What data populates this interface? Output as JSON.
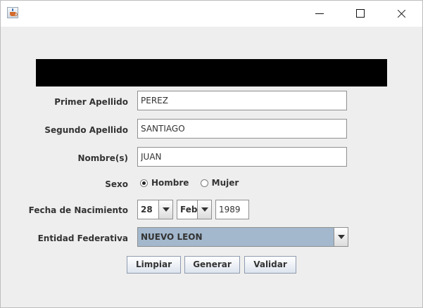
{
  "form": {
    "primer_apellido": {
      "label": "Primer Apellido",
      "value": "PEREZ"
    },
    "segundo_apellido": {
      "label": "Segundo Apellido",
      "value": "SANTIAGO"
    },
    "nombre": {
      "label": "Nombre(s)",
      "value": "JUAN"
    },
    "sexo": {
      "label": "Sexo",
      "options": [
        "Hombre",
        "Mujer"
      ],
      "selected": "Hombre"
    },
    "fecha": {
      "label": "Fecha de Nacimiento",
      "day": "28",
      "month": "Feb",
      "year": "1989"
    },
    "entidad": {
      "label": "Entidad Federativa",
      "value": "NUEVO LEON"
    }
  },
  "buttons": {
    "limpiar": "Limpiar",
    "generar": "Generar",
    "validar": "Validar"
  },
  "icons": {
    "app": "java-icon",
    "minimize": "minimize-icon",
    "maximize": "maximize-icon",
    "close": "close-icon"
  },
  "colors": {
    "window_bg": "#eeeeee",
    "banner": "#000000",
    "combo_selected": "#a3b8cc"
  }
}
